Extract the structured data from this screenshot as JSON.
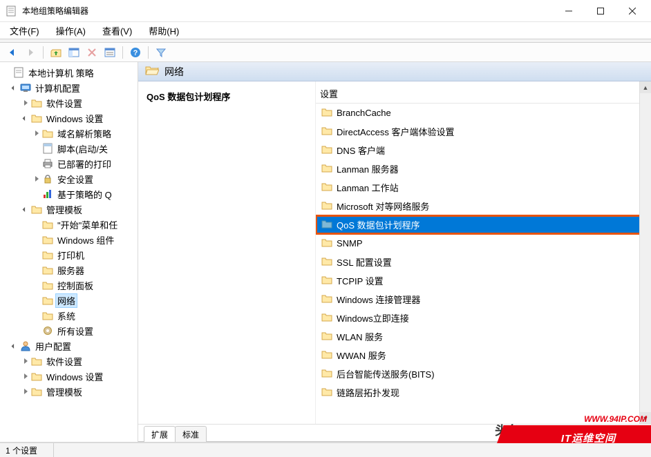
{
  "window": {
    "title": "本地组策略编辑器"
  },
  "menu": {
    "file": "文件(F)",
    "action": "操作(A)",
    "view": "查看(V)",
    "help": "帮助(H)"
  },
  "tree": {
    "root": "本地计算机 策略",
    "comp_config": "计算机配置",
    "soft_settings": "软件设置",
    "win_settings": "Windows 设置",
    "dns_policy": "域名解析策略",
    "scripts": "脚本(启动/关",
    "deployed_printer": "已部署的打印",
    "security": "安全设置",
    "policy_based_q": "基于策略的 Q",
    "admin_templates": "管理模板",
    "start_menu": "\"开始\"菜单和任",
    "win_components": "Windows 组件",
    "printer": "打印机",
    "server": "服务器",
    "control_panel": "控制面板",
    "network": "网络",
    "system": "系统",
    "all_settings": "所有设置",
    "user_config": "用户配置",
    "u_soft_settings": "软件设置",
    "u_win_settings": "Windows 设置",
    "u_admin_templates": "管理模板"
  },
  "list": {
    "header": "网络",
    "left_title": "QoS 数据包计划程序",
    "col_header": "设置",
    "items": [
      "BranchCache",
      "DirectAccess 客户端体验设置",
      "DNS 客户端",
      "Lanman 服务器",
      "Lanman 工作站",
      "Microsoft 对等网络服务",
      "QoS 数据包计划程序",
      "SNMP",
      "SSL 配置设置",
      "TCPIP 设置",
      "Windows 连接管理器",
      "Windows立即连接",
      "WLAN 服务",
      "WWAN 服务",
      "后台智能传送服务(BITS)",
      "链路层拓扑发现"
    ],
    "selected_index": 6
  },
  "tabs": {
    "extended": "扩展",
    "standard": "标准"
  },
  "status": {
    "count": "1 个设置"
  },
  "watermark": {
    "banner": "IT运维空间",
    "url": "WWW.94IP.COM",
    "source": "头条"
  }
}
